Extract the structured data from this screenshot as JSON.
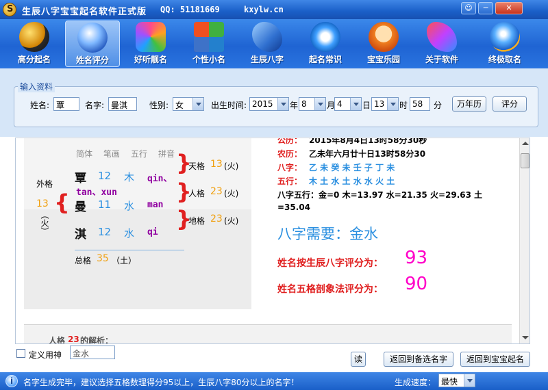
{
  "window": {
    "title": "生辰八字宝宝起名软件正式版",
    "qq": "QQ: 51181669",
    "site": "kxylw.cn",
    "controls": [
      "☺",
      "─",
      "✕"
    ]
  },
  "toolbar": {
    "items": [
      {
        "label": "高分起名",
        "icon": "taiji-icon"
      },
      {
        "label": "姓名评分",
        "icon": "globe-icon",
        "active": true
      },
      {
        "label": "好听靓名",
        "icon": "hexagons-icon"
      },
      {
        "label": "个性小名",
        "icon": "windows-icon"
      },
      {
        "label": "生辰八字",
        "icon": "butterfly-icon"
      },
      {
        "label": "起名常识",
        "icon": "ie-swirl-icon"
      },
      {
        "label": "宝宝乐园",
        "icon": "baby-icon"
      },
      {
        "label": "关于软件",
        "icon": "wings-icon"
      },
      {
        "label": "终极取名",
        "icon": "ie-globe-icon"
      }
    ]
  },
  "form": {
    "legend": "输入资料",
    "surname_label": "姓名:",
    "surname_value": "覃",
    "name_label": "名字:",
    "name_value": "曼淇",
    "gender_label": "性别:",
    "gender_value": "女",
    "birth_label": "出生时间:",
    "year_value": "2015",
    "year_unit": "年",
    "month_value": "8",
    "month_unit": "月",
    "day_value": "4",
    "day_unit": "日",
    "hour_value": "13",
    "hour_unit": "时",
    "minute_value": "58",
    "minute_unit": "分",
    "calendar_button": "万年历",
    "score_button": "评分"
  },
  "analysis": {
    "headers": [
      "简体",
      "笔画",
      "五行",
      "拼音"
    ],
    "chars": [
      {
        "char": "覃",
        "strokes": "12",
        "element": "木",
        "pinyin": "qin、"
      },
      {
        "char": "曼",
        "strokes": "11",
        "element": "水",
        "pinyin": "man"
      },
      {
        "char": "淇",
        "strokes": "12",
        "element": "水",
        "pinyin": "qi"
      }
    ],
    "pinyin_extra": "tan、xun",
    "waige_label": "外格",
    "waige_value": "13",
    "waige_element": "（火）",
    "tiange_label": "天格",
    "tiange_value": "13",
    "tiange_element": "(火)",
    "renge_label": "人格",
    "renge_value": "23",
    "renge_element": "(火)",
    "dige_label": "地格",
    "dige_value": "23",
    "dige_element": "(火)",
    "zongge_label": "总格",
    "zongge_value": "35",
    "zongge_element": "（土）"
  },
  "bazi": {
    "gongli_label": "公历：",
    "gongli_value": "2015年8月4日13时58分30秒",
    "nongli_label": "农历：",
    "nongli_value": "乙未年六月廿十日13时58分30",
    "bazi_label": "八字：",
    "bazi_value": "乙 未 癸 未 壬 子 丁 未",
    "wuxing_label": "五行：",
    "wuxing_value": "木 土 水 土 水 水 火 土",
    "wuxing_count_line1": "八字五行：金=0 木=13.97 水=21.35 火=29.63 土",
    "wuxing_count_line2": "=35.04",
    "need_label": "八字需要：金水",
    "bazi_score_label": "姓名按生辰八字评分为：",
    "bazi_score": "93",
    "wuge_score_label": "姓名五格剖象法评分为：",
    "wuge_score": "90"
  },
  "detail": {
    "renge_prefix": "人格",
    "renge_num": "23",
    "renge_suffix": "的解析："
  },
  "bottom": {
    "custom_label": "定义用神",
    "custom_value": "金水",
    "read_button": "读",
    "back_list_button": "返回到备选名字",
    "back_main_button": "返回到宝宝起名"
  },
  "status": {
    "message": "名字生成完毕，建议选择五格数理得分95以上，生辰八字80分以上的名字！",
    "speed_label": "生成速度：",
    "speed_value": "最快"
  },
  "colors": {
    "titlebar": "#1a5fc8",
    "toolbar": "#1f64d3",
    "panel": "#d6e6f8",
    "red": "#e02020",
    "blue": "#2a8fe0",
    "orange": "#f0a010",
    "purple": "#9000a0",
    "score_pink": "#ff00c8"
  }
}
